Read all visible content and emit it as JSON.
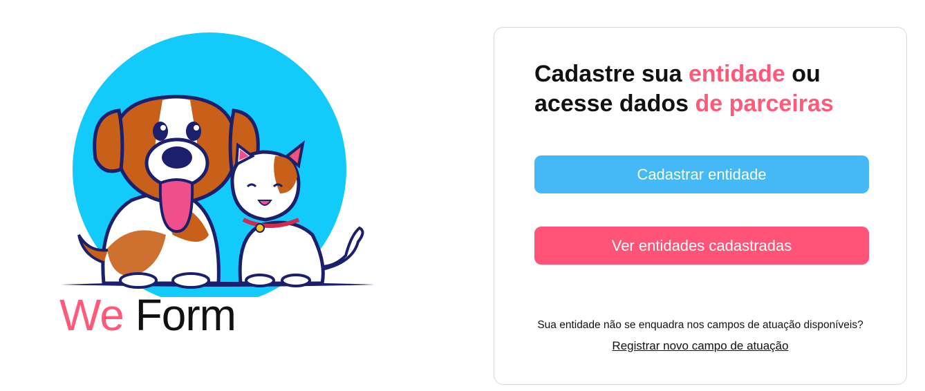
{
  "brand": {
    "we": "We",
    "form": "Form"
  },
  "illustration": {
    "icon": "dog-and-cat-illustration",
    "circle_color": "#12cbfb"
  },
  "card": {
    "headline": {
      "part1": "Cadastre sua ",
      "accent1": "entidade",
      "part2": " ou acesse dados ",
      "accent2": "de parceiras"
    },
    "register_button": "Cadastrar entidade",
    "view_button": "Ver entidades cadastradas",
    "note": "Sua entidade não se enquadra nos campos de atuação disponíveis?",
    "link": "Registrar novo campo de atuação"
  },
  "colors": {
    "accent_pink": "#ff5a7a",
    "button_blue": "#44b9f5",
    "button_pink": "#ff5478"
  }
}
